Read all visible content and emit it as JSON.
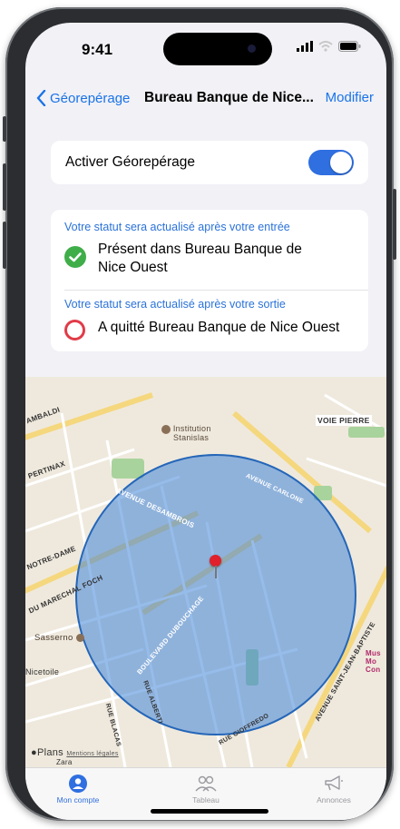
{
  "status_bar": {
    "time": "9:41"
  },
  "nav": {
    "back_label": "Géorepérage",
    "title": "Bureau Banque de Nice...",
    "edit_label": "Modifier"
  },
  "geofence": {
    "toggle_label": "Activer Géorepérage",
    "enabled": true
  },
  "entry": {
    "caption": "Votre statut sera actualisé après votre entrée",
    "line1": "Présent dans Bureau Banque de",
    "line2": "Nice Ouest",
    "icon": "checkmark-circle-icon",
    "color": "#3fae49"
  },
  "exit": {
    "caption": "Votre statut sera actualisé après votre sortie",
    "text": "A quitté Bureau Banque de Nice Ouest",
    "icon": "ring-icon",
    "color": "#e13b48"
  },
  "map": {
    "labels": {
      "institution1": "Institution",
      "institution2": "Stanislas",
      "ambaldi": "AMBALDI",
      "pertinax": "PERTINAX",
      "notredame": "NOTRE-DAME",
      "marechal": "DU MARECHAL FOCH",
      "sasserno": "Sasserno",
      "nicetoile": "Nicetoile",
      "voie_pierre": "VOIE PIERRE",
      "ave_desambrois": "AVENUE DESAMBROIS",
      "ave_carlone": "AVENUE CARLONE",
      "bd_dubouchage": "BOULEVARD DUBOUCHAGE",
      "bd_stjean": "AVENUE SAINT-JEAN-BAPTISTE",
      "rue_gioffredo": "RUE GIOFFREDO",
      "rue_alberti": "RUE ALBERTI",
      "rue_blacas": "RUE BLACAS",
      "museum": "Mus Mo Con",
      "plans": "Plans",
      "legal": "Mentions légales",
      "zara": "Zara"
    },
    "circle_color": "#3f85d8",
    "pin_color": "#e0202a"
  },
  "tabbar": {
    "items": [
      {
        "label": "Mon compte",
        "icon": "person-icon",
        "active": true
      },
      {
        "label": "Tableau",
        "icon": "people-icon",
        "active": false
      },
      {
        "label": "Annonces",
        "icon": "megaphone-icon",
        "active": false
      }
    ]
  }
}
